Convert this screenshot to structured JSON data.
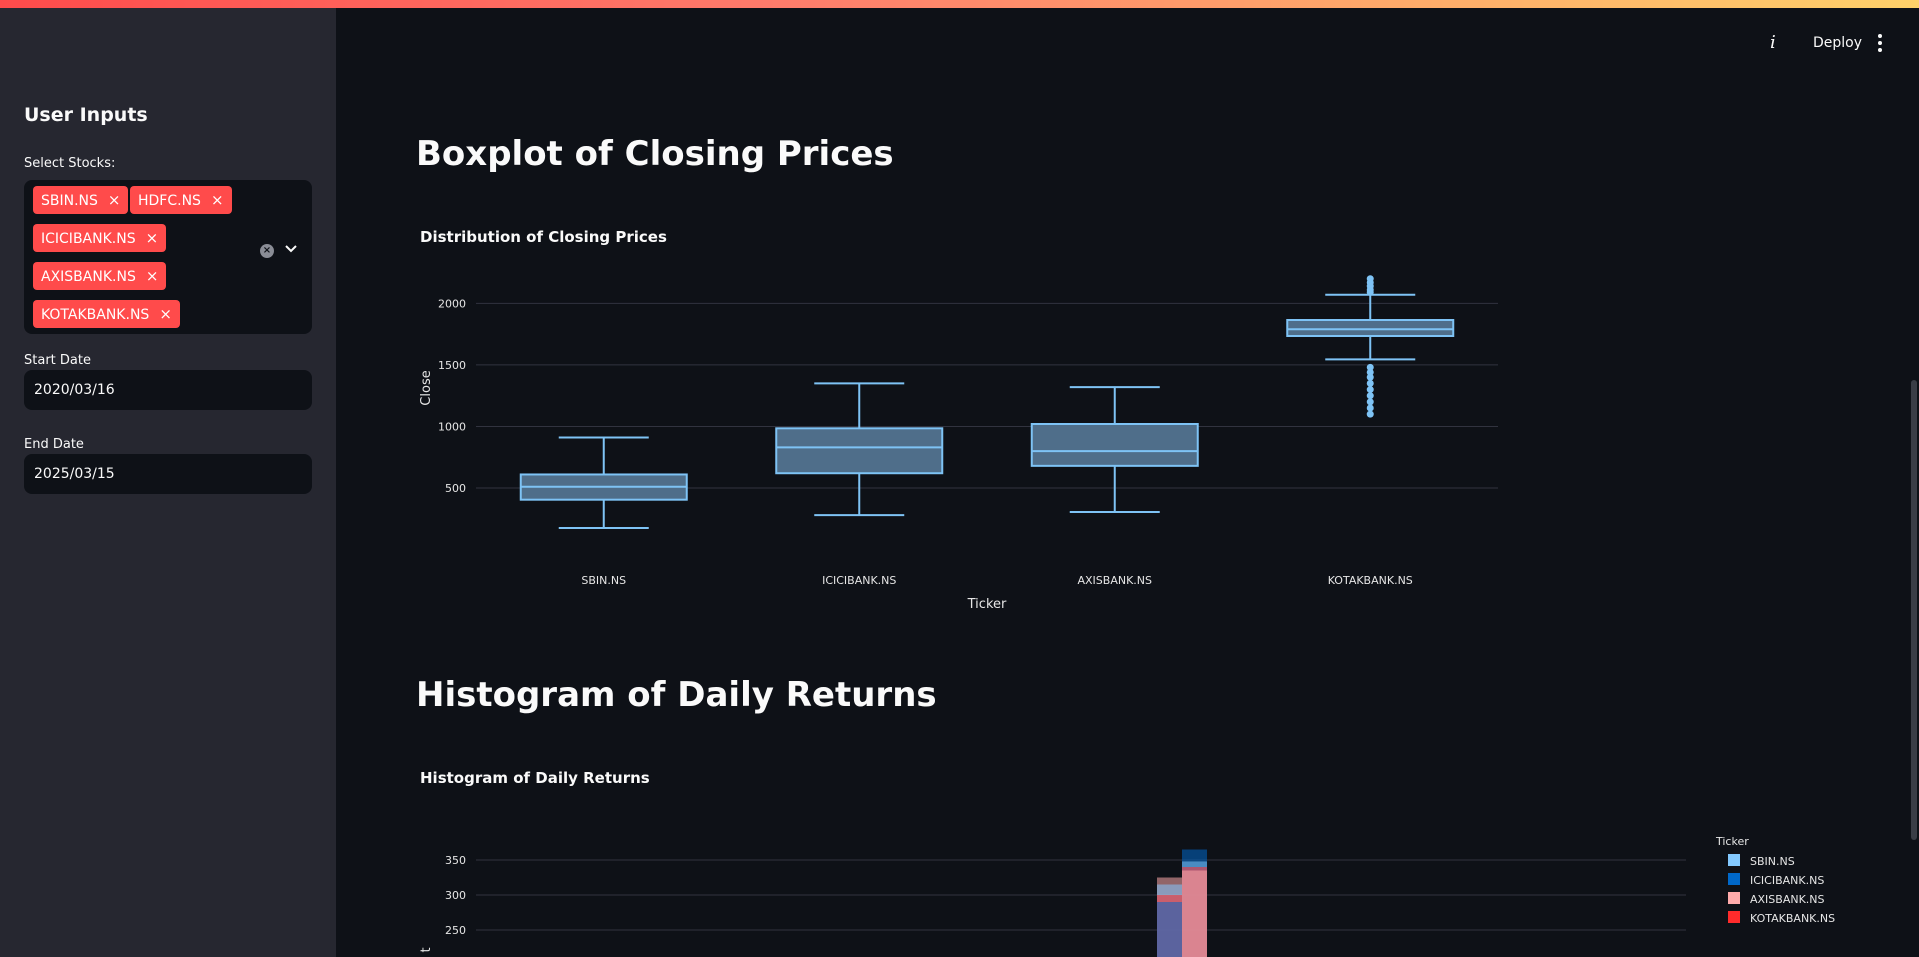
{
  "header": {
    "deploy_label": "Deploy"
  },
  "sidebar": {
    "title": "User Inputs",
    "stocks_label": "Select Stocks:",
    "selected_stocks": [
      "SBIN.NS",
      "HDFC.NS",
      "ICICIBANK.NS",
      "AXISBANK.NS",
      "KOTAKBANK.NS"
    ],
    "start_date_label": "Start Date",
    "start_date_value": "2020/03/16",
    "end_date_label": "End Date",
    "end_date_value": "2025/03/15"
  },
  "main": {
    "section1_title": "Boxplot of Closing Prices",
    "section2_title": "Histogram of Daily Returns"
  },
  "chart_data": [
    {
      "type": "box",
      "title": "Distribution of Closing Prices",
      "xlabel": "Ticker",
      "ylabel": "Close",
      "color": "#7ec3f5",
      "fill": "#4f6e8a",
      "yticks": [
        500,
        1000,
        1500,
        2000
      ],
      "ylim": [
        -150,
        2450
      ],
      "grid": true,
      "categories": [
        "SBIN.NS",
        "ICICIBANK.NS",
        "AXISBANK.NS",
        "KOTAKBANK.NS"
      ],
      "boxes": [
        {
          "min": 175,
          "q1": 405,
          "median": 510,
          "q3": 610,
          "max": 910,
          "outliers": []
        },
        {
          "min": 280,
          "q1": 620,
          "median": 830,
          "q3": 985,
          "max": 1350,
          "outliers": []
        },
        {
          "min": 305,
          "q1": 680,
          "median": 800,
          "q3": 1020,
          "max": 1320,
          "outliers": []
        },
        {
          "min": 1545,
          "q1": 1735,
          "median": 1790,
          "q3": 1865,
          "max": 2070,
          "outliers": [
            2090,
            2110,
            2140,
            2170,
            2200,
            1480,
            1440,
            1400,
            1350,
            1300,
            1250,
            1200,
            1150,
            1100
          ]
        }
      ]
    },
    {
      "type": "histogram",
      "title": "Histogram of Daily Returns",
      "legend_title": "Ticker",
      "legend_position": "right",
      "yticks": [
        250,
        300,
        350
      ],
      "series": [
        {
          "name": "SBIN.NS",
          "color": "#83c9ff"
        },
        {
          "name": "ICICIBANK.NS",
          "color": "#0068c9"
        },
        {
          "name": "AXISBANK.NS",
          "color": "#ffabab"
        },
        {
          "name": "KOTAKBANK.NS",
          "color": "#ff2b2b"
        }
      ],
      "bars": [
        {
          "bin": 0,
          "values": [
            315,
            290,
            325,
            300
          ]
        },
        {
          "bin": 1,
          "values": [
            348,
            365,
            335,
            340
          ]
        }
      ]
    }
  ]
}
